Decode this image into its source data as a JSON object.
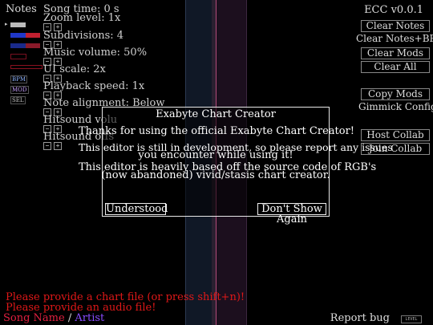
{
  "sidebar": {
    "title": "Notes",
    "modes": [
      "BPM",
      "MOD",
      "SEL"
    ]
  },
  "settings": [
    {
      "label": "Song time: 0 s"
    },
    {
      "label": "Zoom level: 1x"
    },
    {
      "label": "Subdivisions: 4"
    },
    {
      "label": "Music volume: 50%"
    },
    {
      "label": "UI scale: 2x"
    },
    {
      "label": "Playback speed: 1x"
    },
    {
      "label": "Note alignment: Below"
    },
    {
      "label": "Hitsound volu"
    },
    {
      "label": "Hitsound offs"
    }
  ],
  "stepper": {
    "minus": "−",
    "plus": "+"
  },
  "header": {
    "version": "ECC v0.0.1"
  },
  "buttons": {
    "clear_notes": "Clear Notes",
    "clear_notes_bpm": "Clear Notes+BPM",
    "clear_mods": "Clear Mods",
    "clear_all": "Clear All",
    "copy_mods": "Copy Mods",
    "gimmick_config": "Gimmick Config",
    "host_collab": "Host Collab",
    "join_collab": "Join Collab"
  },
  "dialog": {
    "title": "Exabyte Chart Creator",
    "lines": [
      "Thanks for using the official Exabyte Chart Creator!",
      "This editor is still in development, so please report any issues",
      "you encounter while using it!",
      "This editor is heavily based off the source code of RGB's",
      "(now abandoned) vivid/stasis chart creator."
    ],
    "understood": "Understood",
    "dont_show": "Don't Show Again"
  },
  "errors": {
    "chart": "Please provide a chart file (or press shift+n)!",
    "audio": "Please provide an audio file!"
  },
  "footer": {
    "song_name": "Song Name",
    "separator": "/",
    "artist": "Artist",
    "report_bug": "Report bug",
    "level": "LEVEL"
  },
  "colors": {
    "error": "#e01818",
    "song_name": "#e02040",
    "artist": "#8a4cff",
    "lane_line": "#b04a7a"
  }
}
